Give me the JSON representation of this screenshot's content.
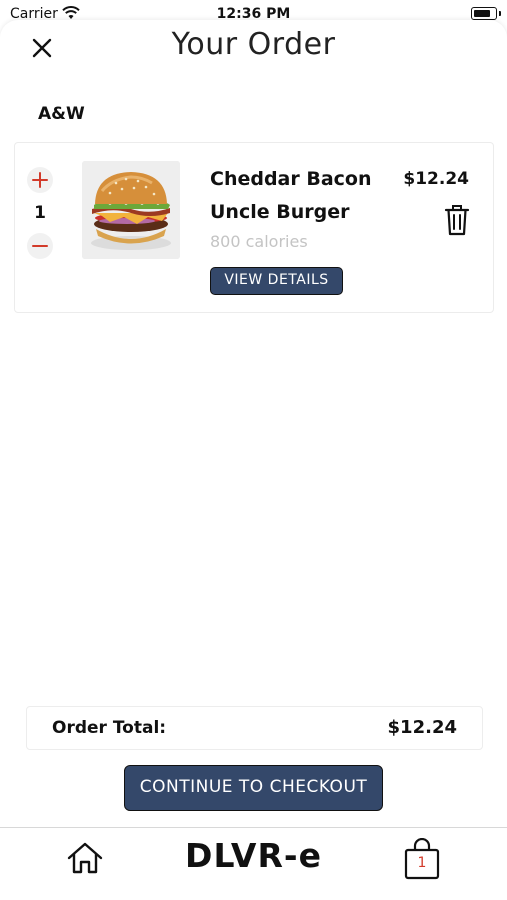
{
  "status_bar": {
    "carrier": "Carrier",
    "time": "12:36 PM"
  },
  "header": {
    "title": "Your Order"
  },
  "restaurant": {
    "name": "A&W"
  },
  "order_items": [
    {
      "quantity": "1",
      "name": "Cheddar Bacon Uncle Burger",
      "calories": "800 calories",
      "price": "$12.24",
      "details_label": "VIEW DETAILS"
    }
  ],
  "total": {
    "label": "Order Total:",
    "value": "$12.24"
  },
  "checkout": {
    "label": "CONTINUE TO CHECKOUT"
  },
  "bottom_nav": {
    "brand": "DLVR-e",
    "cart_count": "1"
  },
  "colors": {
    "primary": "#34486a",
    "accent_red": "#d23a2a",
    "muted": "#c4c4c4"
  },
  "icons": [
    "wifi-icon",
    "battery-icon",
    "close-icon",
    "plus-icon",
    "minus-icon",
    "trash-icon",
    "home-icon",
    "shopping-bag-icon"
  ]
}
